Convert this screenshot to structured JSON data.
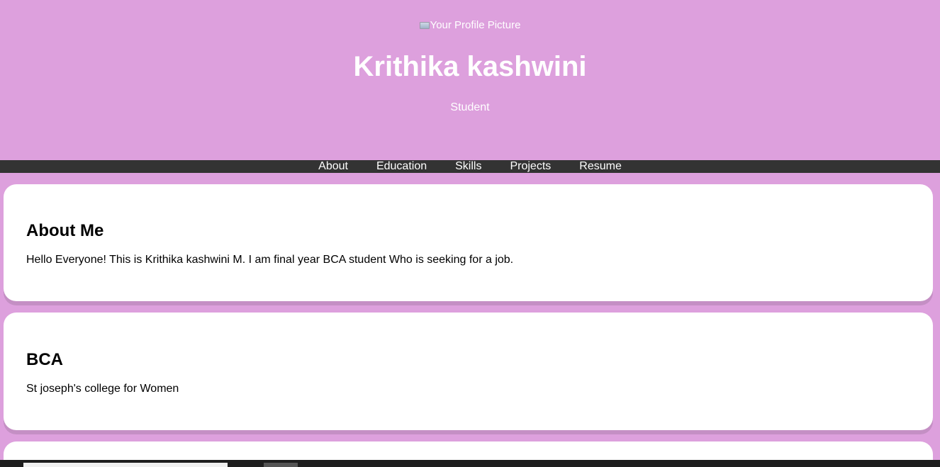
{
  "header": {
    "profile_picture_alt": "Your Profile Picture",
    "name": "Krithika kashwini",
    "subtitle": "Student"
  },
  "nav": {
    "items": [
      {
        "label": "About"
      },
      {
        "label": "Education"
      },
      {
        "label": "Skills"
      },
      {
        "label": "Projects"
      },
      {
        "label": "Resume"
      }
    ]
  },
  "about": {
    "heading": "About Me",
    "text": "Hello Everyone! This is Krithika kashwini M. I am final year BCA student Who is seeking for a job."
  },
  "education": {
    "heading": "BCA",
    "text": "St joseph's college for Women"
  },
  "colors": {
    "page_background": "#dda0dd",
    "nav_background": "#333333",
    "card_background": "#ffffff"
  }
}
